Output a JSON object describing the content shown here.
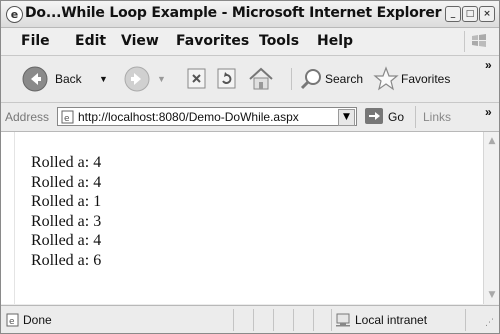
{
  "window": {
    "title": "Do...While Loop Example - Microsoft Internet Explorer"
  },
  "menu": [
    {
      "label": "File"
    },
    {
      "label": "Edit"
    },
    {
      "label": "View"
    },
    {
      "label": "Favorites"
    },
    {
      "label": "Tools"
    },
    {
      "label": "Help"
    }
  ],
  "toolbar": {
    "back_label": "Back",
    "search_label": "Search",
    "favorites_label": "Favorites"
  },
  "address": {
    "label": "Address",
    "url": "http://localhost:8080/Demo-DoWhile.aspx",
    "go_label": "Go",
    "links_label": "Links"
  },
  "content": {
    "lines": [
      "Rolled a: 4",
      "Rolled a: 4",
      "Rolled a: 1",
      "Rolled a: 3",
      "Rolled a: 4",
      "Rolled a: 6"
    ]
  },
  "status": {
    "text": "Done",
    "zone": "Local intranet"
  }
}
